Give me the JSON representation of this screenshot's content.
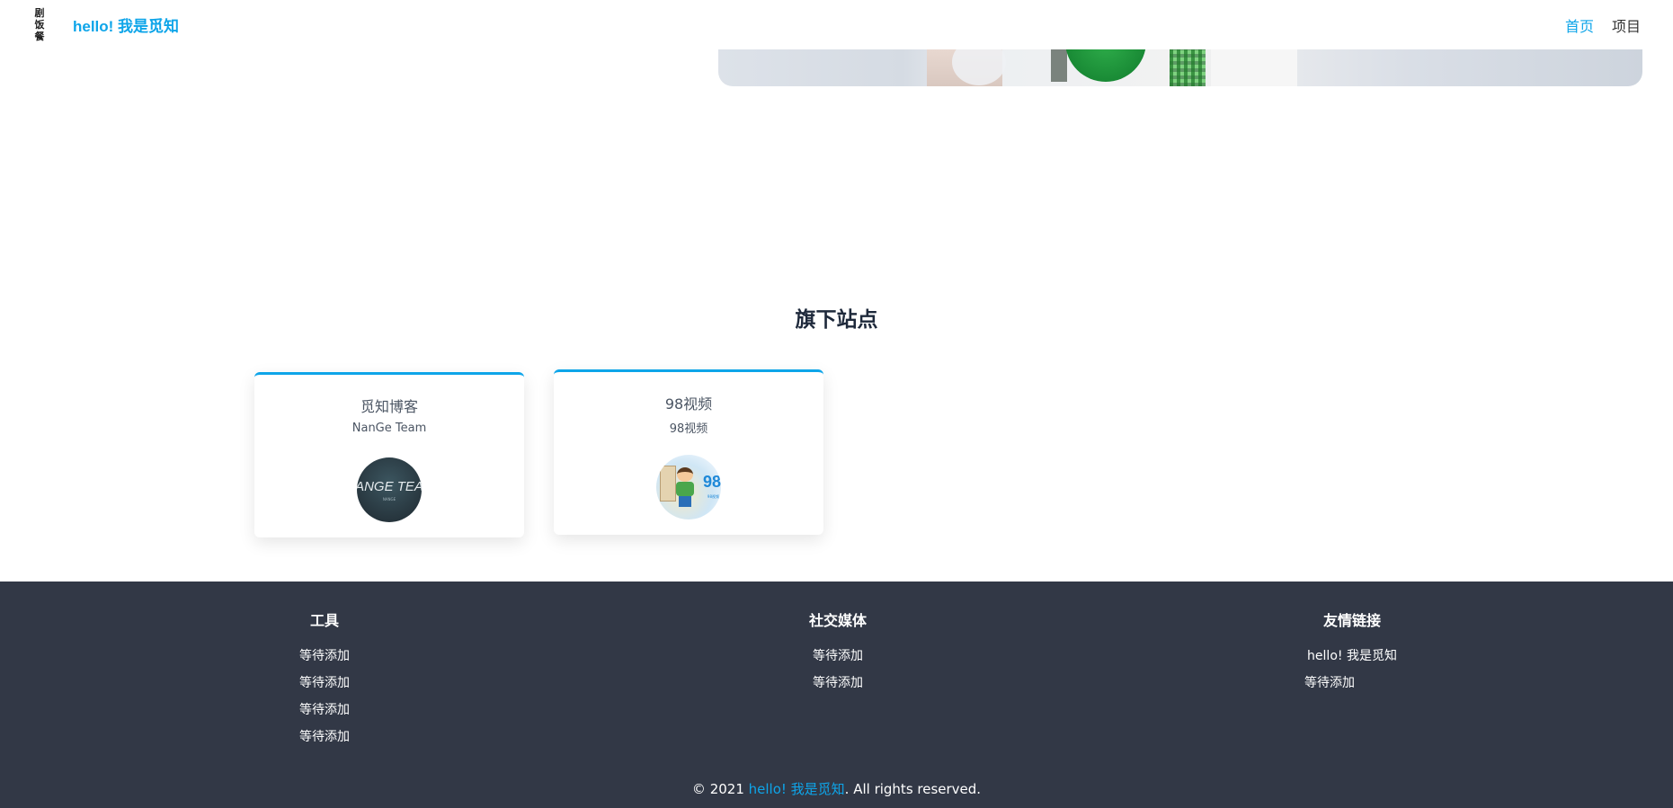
{
  "header": {
    "logo_chars": [
      "剧",
      "饭",
      "餐"
    ],
    "brand": "hello! 我是觅知",
    "nav": [
      {
        "label": "首页",
        "active": true
      },
      {
        "label": "项目",
        "active": false
      }
    ]
  },
  "section": {
    "title": "旗下站点",
    "cards": [
      {
        "title": "觅知博客",
        "subtitle": "NanGe Team",
        "avatar_text": "ANGE TEA",
        "avatar_sub": "NANGE"
      },
      {
        "title": "98视频",
        "subtitle": "98视频",
        "avatar_text": "98",
        "avatar_sub": "98视频"
      }
    ]
  },
  "footer": {
    "columns": [
      {
        "title": "工具",
        "items": [
          "等待添加",
          "等待添加",
          "等待添加",
          "等待添加"
        ]
      },
      {
        "title": "社交媒体",
        "items": [
          "等待添加",
          "等待添加"
        ]
      },
      {
        "title": "友情链接",
        "items": [
          "hello! 我是觅知",
          "等待添加"
        ]
      }
    ],
    "copyright_prefix": "© 2021 ",
    "copyright_brand": "hello! 我是觅知",
    "copyright_suffix": ". All rights reserved."
  },
  "colors": {
    "accent": "#0ea5e9",
    "footer_bg": "#323846",
    "title": "#1e293b"
  }
}
